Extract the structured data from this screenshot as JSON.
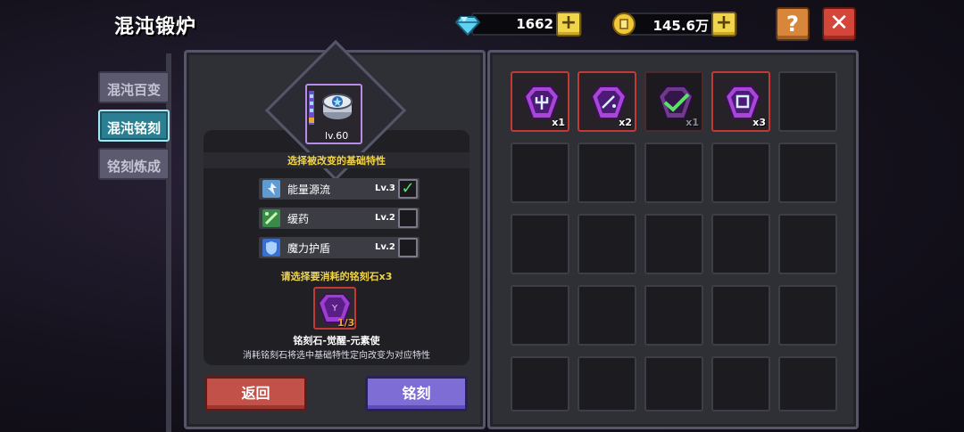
{
  "header": {
    "title": "混沌锻炉"
  },
  "currency": {
    "gems": "1662",
    "gold": "145.6万"
  },
  "buttons": {
    "help": "?",
    "close": "✕",
    "plus": "+",
    "back": "返回",
    "carve": "铭刻"
  },
  "tabs": [
    {
      "label": "混沌百变",
      "active": false
    },
    {
      "label": "混沌铭刻",
      "active": true
    },
    {
      "label": "铭刻炼成",
      "active": false
    }
  ],
  "item": {
    "level": "lv.60"
  },
  "attributes": {
    "section_title": "选择被改变的基础特性",
    "rows": [
      {
        "name": "能量源流",
        "level": "Lv.3",
        "checked": true,
        "icon": "energy-flow-icon"
      },
      {
        "name": "缓药",
        "level": "Lv.2",
        "checked": false,
        "icon": "slow-potion-icon"
      },
      {
        "name": "魔力护盾",
        "level": "Lv.2",
        "checked": false,
        "icon": "mana-shield-icon"
      }
    ]
  },
  "stone": {
    "section_title": "请选择要消耗的铭刻石x3",
    "count": "1/3",
    "name": "铭刻石-觉醒-元素使",
    "description": "消耗铭刻石将选中基础特性定向改变为对应特性"
  },
  "inventory": [
    {
      "icon": "inscription-stone-trident-icon",
      "qty": "x1",
      "state": "filled"
    },
    {
      "icon": "inscription-stone-sparkle-icon",
      "qty": "x2",
      "state": "filled"
    },
    {
      "icon": "inscription-stone-check-icon",
      "qty": "x1",
      "state": "dim"
    },
    {
      "icon": "inscription-stone-rune-icon",
      "qty": "x3",
      "state": "filled"
    }
  ],
  "colors": {
    "accent_yellow": "#f0d44a",
    "tab_active": "#2b7f92",
    "back_button": "#c2514a",
    "carve_button": "#7d6dd5",
    "selected_border": "#c23a35"
  }
}
